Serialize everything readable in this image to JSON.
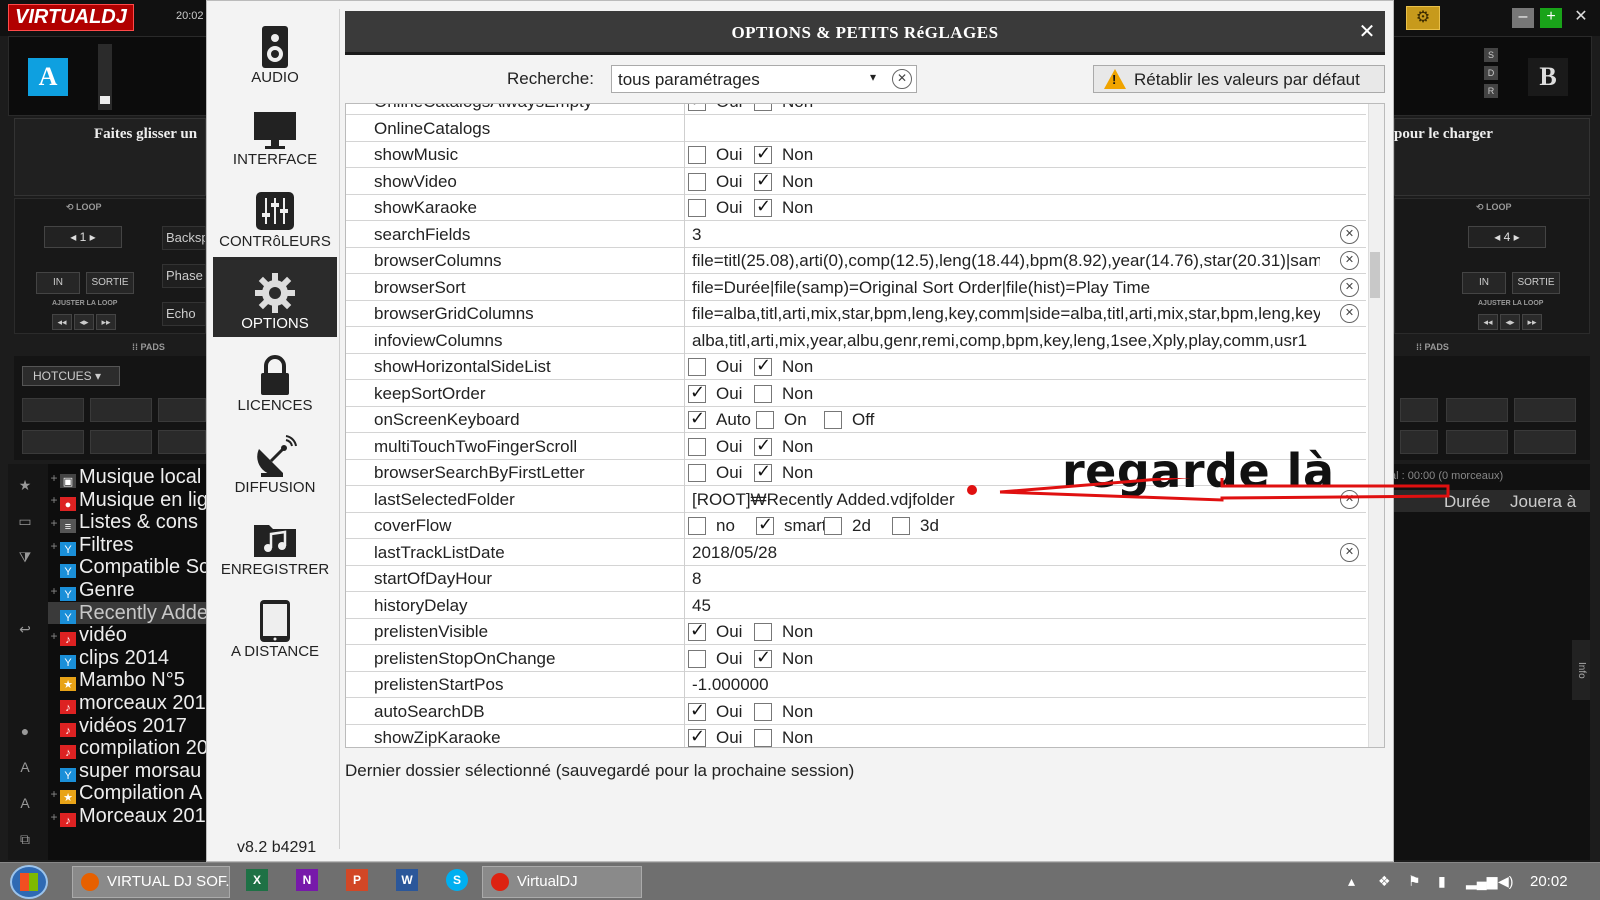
{
  "app": {
    "logo": "VIRTUALDJ",
    "clock_small": "20:02",
    "deck_a_letter": "A",
    "deck_b_letter": "B",
    "sdr": [
      "S",
      "D",
      "R"
    ],
    "drag_hint_left": "Faites glisser un",
    "drag_hint_right": "pour le charger",
    "loop_label": "LOOP",
    "loop_value_a": "1",
    "loop_value_b": "4",
    "in_label": "IN",
    "out_label": "SORTIE",
    "adjust_loop_label": "AJUSTER LA LOOP",
    "mid_buttons": [
      "Backsp",
      "Phase",
      "Echo"
    ],
    "pads_label": "PADS",
    "hotcues_label": "HOTCUES",
    "tree_items": [
      {
        "label": "Musique local",
        "expand": "+",
        "icon": "computer-icon",
        "color": "#444"
      },
      {
        "label": "Musique en lig",
        "expand": "+",
        "icon": "online-icon",
        "color": "#d22"
      },
      {
        "label": "Listes & cons",
        "expand": "+",
        "icon": "list-icon",
        "color": "#555"
      },
      {
        "label": "Filtres",
        "expand": "+",
        "icon": "filter-icon",
        "color": "#1a8fd8"
      },
      {
        "label": "Compatible Sc",
        "expand": "",
        "icon": "filter-icon",
        "color": "#1a8fd8"
      },
      {
        "label": "Genre",
        "expand": "+",
        "icon": "filter-icon",
        "color": "#1a8fd8"
      },
      {
        "label": "Recently Adde",
        "expand": "",
        "icon": "filter-icon",
        "color": "#1a8fd8"
      },
      {
        "label": "vidéo",
        "expand": "+",
        "icon": "playlist-icon",
        "color": "#d22"
      },
      {
        "label": "clips 2014",
        "expand": "",
        "icon": "filter-icon",
        "color": "#1a8fd8"
      },
      {
        "label": "Mambo N°5",
        "expand": "",
        "icon": "star-icon",
        "color": "#e8a317"
      },
      {
        "label": "morceaux 201",
        "expand": "",
        "icon": "playlist-icon",
        "color": "#d22"
      },
      {
        "label": "vidéos 2017",
        "expand": "",
        "icon": "playlist-icon",
        "color": "#d22"
      },
      {
        "label": "compilation 20",
        "expand": "",
        "icon": "playlist-icon",
        "color": "#d22"
      },
      {
        "label": "super morsau",
        "expand": "",
        "icon": "filter-icon",
        "color": "#1a8fd8"
      },
      {
        "label": "Compilation A",
        "expand": "+",
        "icon": "star-icon",
        "color": "#e8a317"
      },
      {
        "label": "Morceaux 201",
        "expand": "+",
        "icon": "playlist-icon",
        "color": "#d22"
      }
    ],
    "right_browser_info": "al : 00:00 (0 morceaux)",
    "right_cols": [
      "Durée",
      "Jouera à"
    ],
    "info_tab": "Info"
  },
  "dialog": {
    "title": "OPTIONS & PETITS RéGLAGES",
    "close_glyph": "✕",
    "nav": [
      {
        "label": "AUDIO",
        "icon": "speaker-icon"
      },
      {
        "label": "INTERFACE",
        "icon": "monitor-icon"
      },
      {
        "label": "CONTRôLEURS",
        "icon": "sliders-icon"
      },
      {
        "label": "OPTIONS",
        "icon": "gear-icon",
        "active": true
      },
      {
        "label": "LICENCES",
        "icon": "lock-icon"
      },
      {
        "label": "DIFFUSION",
        "icon": "satellite-dish-icon"
      },
      {
        "label": "ENREGISTRER",
        "icon": "music-folder-icon"
      },
      {
        "label": "A DISTANCE",
        "icon": "tablet-icon"
      }
    ],
    "version": "v8.2 b4291",
    "search": {
      "label": "Recherche:",
      "value": "tous paramétrages"
    },
    "reset_label": "Rétablir les valeurs par défaut",
    "description": "Dernier dossier sélectionné (sauvegardé pour la prochaine session)",
    "rows": [
      {
        "name": "OnlineCatalogsAlwaysEmpty",
        "type": "check",
        "options": [
          {
            "label": "Oui",
            "checked": true
          },
          {
            "label": "Non",
            "checked": false
          }
        ]
      },
      {
        "name": "OnlineCatalogs",
        "type": "text",
        "value": ""
      },
      {
        "name": "showMusic",
        "type": "check",
        "options": [
          {
            "label": "Oui",
            "checked": false
          },
          {
            "label": "Non",
            "checked": true
          }
        ]
      },
      {
        "name": "showVideo",
        "type": "check",
        "options": [
          {
            "label": "Oui",
            "checked": false
          },
          {
            "label": "Non",
            "checked": true
          }
        ]
      },
      {
        "name": "showKaraoke",
        "type": "check",
        "options": [
          {
            "label": "Oui",
            "checked": false
          },
          {
            "label": "Non",
            "checked": true
          }
        ]
      },
      {
        "name": "searchFields",
        "type": "text",
        "value": "3",
        "clear": true
      },
      {
        "name": "browserColumns",
        "type": "text",
        "value": "file=titl(25.08),arti(0),comp(12.5),leng(18.44),bpm(8.92),year(14.76),star(20.31)|sam",
        "clear": true
      },
      {
        "name": "browserSort",
        "type": "text",
        "value": "file=Durée|file(samp)=Original Sort Order|file(hist)=Play Time",
        "clear": true
      },
      {
        "name": "browserGridColumns",
        "type": "text",
        "value": "file=alba,titl,arti,mix,star,bpm,leng,key,comm|side=alba,titl,arti,mix,star,bpm,leng,key",
        "clear": true
      },
      {
        "name": "infoviewColumns",
        "type": "text",
        "value": "alba,titl,arti,mix,year,albu,genr,remi,comp,bpm,key,leng,1see,Xply,play,comm,usr1",
        "clear": false
      },
      {
        "name": "showHorizontalSideList",
        "type": "check",
        "options": [
          {
            "label": "Oui",
            "checked": false
          },
          {
            "label": "Non",
            "checked": true
          }
        ]
      },
      {
        "name": "keepSortOrder",
        "type": "check",
        "options": [
          {
            "label": "Oui",
            "checked": true
          },
          {
            "label": "Non",
            "checked": false
          }
        ]
      },
      {
        "name": "onScreenKeyboard",
        "type": "check",
        "options": [
          {
            "label": "Auto",
            "checked": true
          },
          {
            "label": "On",
            "checked": false
          },
          {
            "label": "Off",
            "checked": false
          }
        ]
      },
      {
        "name": "multiTouchTwoFingerScroll",
        "type": "check",
        "options": [
          {
            "label": "Oui",
            "checked": false
          },
          {
            "label": "Non",
            "checked": true
          }
        ]
      },
      {
        "name": "browserSearchByFirstLetter",
        "type": "check",
        "options": [
          {
            "label": "Oui",
            "checked": false
          },
          {
            "label": "Non",
            "checked": true
          }
        ]
      },
      {
        "name": "lastSelectedFolder",
        "type": "text",
        "value": "[ROOT]₩Recently Added.vdjfolder",
        "clear": true
      },
      {
        "name": "coverFlow",
        "type": "check",
        "options": [
          {
            "label": "no",
            "checked": false
          },
          {
            "label": "smart",
            "checked": true
          },
          {
            "label": "2d",
            "checked": false
          },
          {
            "label": "3d",
            "checked": false
          }
        ]
      },
      {
        "name": "lastTrackListDate",
        "type": "text",
        "value": "2018/05/28",
        "clear": true
      },
      {
        "name": "startOfDayHour",
        "type": "text",
        "value": "8",
        "clear": false
      },
      {
        "name": "historyDelay",
        "type": "text",
        "value": "45",
        "clear": false
      },
      {
        "name": "prelistenVisible",
        "type": "check",
        "options": [
          {
            "label": "Oui",
            "checked": true
          },
          {
            "label": "Non",
            "checked": false
          }
        ]
      },
      {
        "name": "prelistenStopOnChange",
        "type": "check",
        "options": [
          {
            "label": "Oui",
            "checked": false
          },
          {
            "label": "Non",
            "checked": true
          }
        ]
      },
      {
        "name": "prelistenStartPos",
        "type": "text",
        "value": "-1.000000",
        "clear": false
      },
      {
        "name": "autoSearchDB",
        "type": "check",
        "options": [
          {
            "label": "Oui",
            "checked": true
          },
          {
            "label": "Non",
            "checked": false
          }
        ]
      },
      {
        "name": "showZipKaraoke",
        "type": "check",
        "options": [
          {
            "label": "Oui",
            "checked": true
          },
          {
            "label": "Non",
            "checked": false
          }
        ]
      }
    ]
  },
  "annotation": {
    "text": "regarde là",
    "color": "#e01010"
  },
  "taskbar": {
    "tasks": [
      {
        "label": "VIRTUAL DJ SOF...",
        "icon": "firefox-icon",
        "color": "#e66000"
      },
      {
        "label": "VirtualDJ",
        "icon": "virtualdj-icon",
        "color": "#d21"
      }
    ],
    "pinned": [
      {
        "label": "X",
        "icon": "excel-icon",
        "color": "#1e7145"
      },
      {
        "label": "N",
        "icon": "onenote-icon",
        "color": "#7719aa"
      },
      {
        "label": "P",
        "icon": "powerpoint-icon",
        "color": "#d24726"
      },
      {
        "label": "W",
        "icon": "word-icon",
        "color": "#2b579a"
      },
      {
        "label": "S",
        "icon": "skype-icon",
        "color": "#00aff0"
      }
    ],
    "clock": "20:02"
  }
}
